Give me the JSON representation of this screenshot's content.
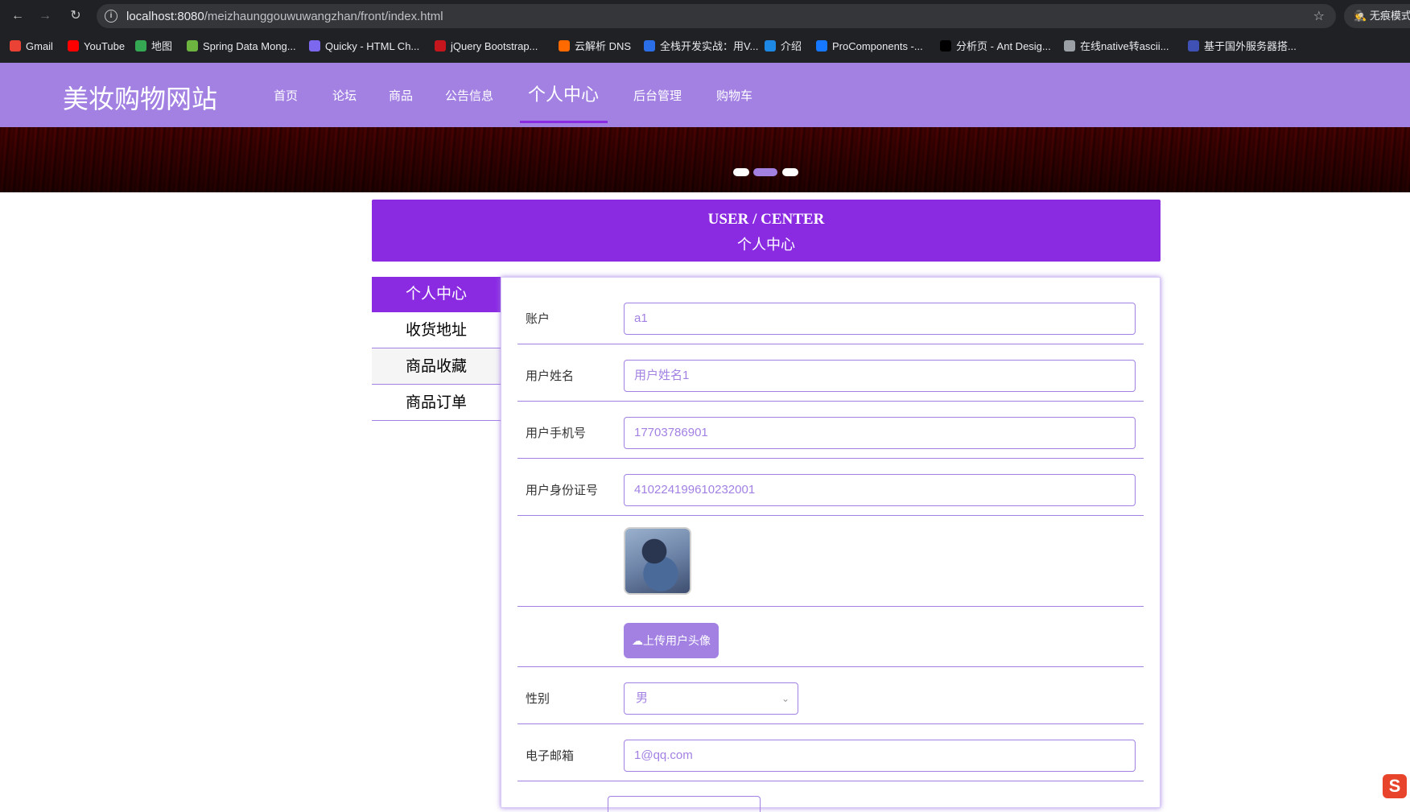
{
  "browser": {
    "url_host": "localhost:8080",
    "url_path": "/meizhaunggouwuwangzhan/front/index.html",
    "incognito_label": "无痕模式",
    "bookmarks": [
      {
        "label": "Gmail",
        "color": "#ea4335"
      },
      {
        "label": "YouTube",
        "color": "#ff0000"
      },
      {
        "label": "地图",
        "color": "#34a853"
      },
      {
        "label": "Spring Data Mong...",
        "color": "#6db33f"
      },
      {
        "label": "Quicky - HTML Ch...",
        "color": "#7b68ee"
      },
      {
        "label": "jQuery Bootstrap...",
        "color": "#c4161c"
      },
      {
        "label": "云解析 DNS",
        "color": "#ff6a00"
      },
      {
        "label": "全栈开发实战：用V...",
        "color": "#2a6ee8"
      },
      {
        "label": "介绍",
        "color": "#1e88e5"
      },
      {
        "label": "ProComponents -...",
        "color": "#1677ff"
      },
      {
        "label": "分析页 - Ant Desig...",
        "color": "#000000"
      },
      {
        "label": "在线native转ascii...",
        "color": "#9aa0a6"
      },
      {
        "label": "基于国外服务器搭...",
        "color": "#3f51b5"
      }
    ]
  },
  "site": {
    "logo": "美妆购物网站",
    "nav": [
      "首页",
      "论坛",
      "商品",
      "公告信息",
      "个人中心",
      "后台管理",
      "购物车"
    ],
    "active_nav": "个人中心",
    "colors": {
      "header": "#a281e3",
      "accent": "#8a2be2"
    }
  },
  "carousel": {
    "slides": 3,
    "active": 2
  },
  "user_center": {
    "title_en": "USER / CENTER",
    "title_cn": "个人中心",
    "menu": [
      "个人中心",
      "收货地址",
      "商品收藏",
      "商品订单"
    ],
    "form": {
      "account_label": "账户",
      "account_value": "a1",
      "name_label": "用户姓名",
      "name_value": "用户姓名1",
      "phone_label": "用户手机号",
      "phone_value": "17703786901",
      "idcard_label": "用户身份证号",
      "idcard_value": "410224199610232001",
      "upload_label": "上传用户头像",
      "gender_label": "性别",
      "gender_value": "男",
      "email_label": "电子邮箱",
      "email_value": "1@qq.com"
    }
  }
}
